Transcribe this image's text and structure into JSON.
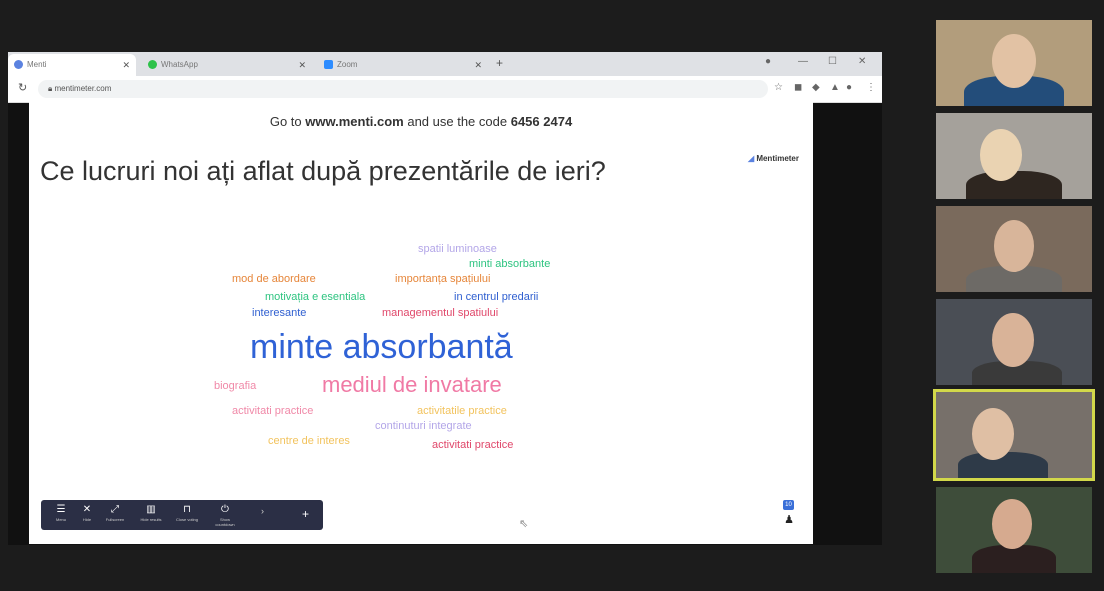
{
  "browser": {
    "tabs": [
      {
        "label": "Menti",
        "favicon_color": "#5b82e0"
      },
      {
        "label": "WhatsApp",
        "favicon_color": "#2ec24a"
      },
      {
        "label": "Zoom",
        "favicon_color": "#2d8cff"
      }
    ],
    "new_tab_label": "+",
    "url": "mentimeter.com"
  },
  "slide": {
    "instruction_prefix": "Go to ",
    "instruction_site": "www.menti.com",
    "instruction_mid": " and use the code ",
    "instruction_code": "6456 2474",
    "question": "Ce lucruri noi ați aflat după prezentările de ieri?",
    "brand": "Mentimeter",
    "word_cloud": [
      {
        "text": "spatii luminoase",
        "color": "#b3a6e8"
      },
      {
        "text": "minti absorbante",
        "color": "#2ec480"
      },
      {
        "text": "mod de abordare",
        "color": "#e6863a"
      },
      {
        "text": "importanța spațiului",
        "color": "#e6863a"
      },
      {
        "text": "motivația e esentiala",
        "color": "#2ec480"
      },
      {
        "text": "in centrul predarii",
        "color": "#2f5fd0"
      },
      {
        "text": "interesante",
        "color": "#2f5fd0"
      },
      {
        "text": "managementul spatiului",
        "color": "#e0476a"
      },
      {
        "text": "minte absorbantă",
        "color": "#2f62d6"
      },
      {
        "text": "biografia",
        "color": "#f089a8"
      },
      {
        "text": "mediul de invatare",
        "color": "#f07aa5"
      },
      {
        "text": "activitati practice",
        "color": "#f089a8"
      },
      {
        "text": "activitatile practice",
        "color": "#f2c35e"
      },
      {
        "text": "continuturi integrate",
        "color": "#b3a6e8"
      },
      {
        "text": "centre de interes",
        "color": "#f2c35e"
      },
      {
        "text": "activitati practice",
        "color": "#e0476a"
      }
    ],
    "toolbar": {
      "buttons": [
        {
          "icon": "menu-icon",
          "label": "Menu"
        },
        {
          "icon": "close-icon",
          "label": "Hide"
        },
        {
          "icon": "fullscreen-icon",
          "label": "Fullscreen"
        },
        {
          "icon": "hide-results-icon",
          "label": "Hide results"
        },
        {
          "icon": "lock-icon",
          "label": "Close voting"
        },
        {
          "icon": "timer-icon",
          "label": "Show countdown"
        }
      ],
      "more": "›",
      "add": "+"
    },
    "response_count": "10"
  },
  "participants": [
    {
      "id": "p1",
      "bg": "#b29d7c",
      "skin": "#e2c2a4",
      "shirt": "#234d7a"
    },
    {
      "id": "p2",
      "bg": "#a5a19b",
      "skin": "#ead3b2",
      "shirt": "#2e2620"
    },
    {
      "id": "p3",
      "bg": "#7a6a5c",
      "skin": "#d8b59a",
      "shirt": "#6d6a66"
    },
    {
      "id": "p4",
      "bg": "#4a4e55",
      "skin": "#d9b398",
      "shirt": "#3a3a3a"
    },
    {
      "id": "p5",
      "bg": "#77706a",
      "skin": "#dfbfa4",
      "shirt": "#2e3a48",
      "active": true
    },
    {
      "id": "p6",
      "bg": "#3e4d3a",
      "skin": "#d6aa8f",
      "shirt": "#2b1f1f"
    }
  ]
}
